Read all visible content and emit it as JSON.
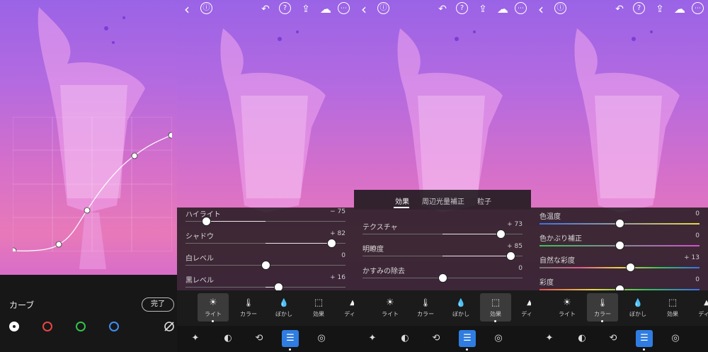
{
  "top_icons": {
    "back": "‹",
    "info": "ⓘ",
    "undo": "↶",
    "help": "?",
    "share": "⇪",
    "cloud": "☁",
    "more": "⋯"
  },
  "curve_panel": {
    "title": "カーブ",
    "done_label": "完了",
    "channels": [
      "white",
      "red",
      "green",
      "blue"
    ],
    "channel_colors": {
      "white": "#ffffff",
      "red": "#e84545",
      "green": "#33c24a",
      "blue": "#3f8ef0"
    },
    "icons": [
      "link-off-icon"
    ]
  },
  "light_panel": {
    "sliders": [
      {
        "label": "ハイライト",
        "value": "− 75",
        "fraction": 0.13
      },
      {
        "label": "シャドウ",
        "value": "+ 82",
        "fraction": 0.91
      },
      {
        "label": "白レベル",
        "value": "0",
        "fraction": 0.5
      },
      {
        "label": "黒レベル",
        "value": "+ 16",
        "fraction": 0.58
      }
    ]
  },
  "effects_panel": {
    "subtabs": [
      "効果",
      "周辺光量補正",
      "粒子"
    ],
    "sliders": [
      {
        "label": "テクスチャ",
        "value": "+ 73",
        "fraction": 0.865
      },
      {
        "label": "明瞭度",
        "value": "+ 85",
        "fraction": 0.925
      },
      {
        "label": "かすみの除去",
        "value": "0",
        "fraction": 0.5
      }
    ]
  },
  "color_panel": {
    "sliders": [
      {
        "label": "色温度",
        "value": "0",
        "fraction": 0.5
      },
      {
        "label": "色かぶり補正",
        "value": "0",
        "fraction": 0.5
      },
      {
        "label": "自然な彩度",
        "value": "+ 13",
        "fraction": 0.565
      },
      {
        "label": "彩度",
        "value": "0",
        "fraction": 0.5
      }
    ]
  },
  "tool_tabs": {
    "light": "ライト",
    "color": "カラー",
    "blur": "ぼかし",
    "effects": "効果",
    "detail": "ディテ"
  },
  "tab_glyphs": {
    "light": "☀",
    "color": "🌡",
    "blur": "💧",
    "effects": "⬚",
    "detail": "▲"
  },
  "bottom_tools": [
    "magic-wand-icon",
    "heal-icon",
    "crop-icon",
    "adjust-icon",
    "presets-icon"
  ],
  "colors": {
    "accent": "#2f7de1",
    "panel_bg": "#141414",
    "photo_top": "#9a63e6",
    "photo_bottom": "#e879b9"
  }
}
